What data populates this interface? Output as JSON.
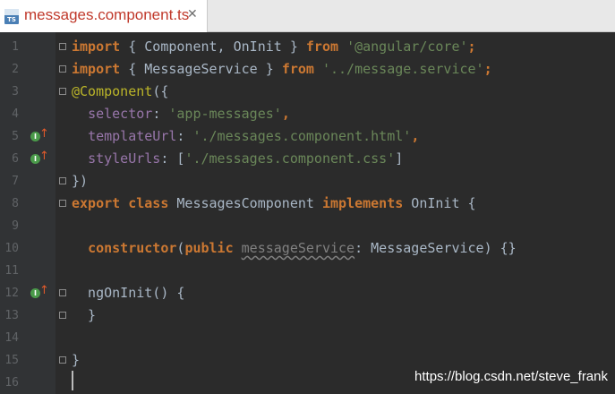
{
  "tab": {
    "title": "messages.component.ts",
    "icon_label": "TS",
    "close": "✕"
  },
  "line_numbers": [
    "1",
    "2",
    "3",
    "4",
    "5",
    "6",
    "7",
    "8",
    "9",
    "10",
    "11",
    "12",
    "13",
    "14",
    "15",
    "16"
  ],
  "code_lines": [
    [
      [
        "kw",
        "import"
      ],
      [
        "plain",
        " { Component, OnInit } "
      ],
      [
        "kw",
        "from"
      ],
      [
        "plain",
        " "
      ],
      [
        "str",
        "'@angular/core'"
      ],
      [
        "kw",
        ";"
      ]
    ],
    [
      [
        "kw",
        "import"
      ],
      [
        "plain",
        " { MessageService } "
      ],
      [
        "kw",
        "from"
      ],
      [
        "plain",
        " "
      ],
      [
        "str",
        "'../message.service'"
      ],
      [
        "kw",
        ";"
      ]
    ],
    [
      [
        "dec",
        "@Component"
      ],
      [
        "plain",
        "({"
      ]
    ],
    [
      [
        "plain",
        "  "
      ],
      [
        "prop",
        "selector"
      ],
      [
        "plain",
        ": "
      ],
      [
        "str",
        "'app-messages'"
      ],
      [
        "kw",
        ","
      ]
    ],
    [
      [
        "plain",
        "  "
      ],
      [
        "prop",
        "templateUrl"
      ],
      [
        "plain",
        ": "
      ],
      [
        "str",
        "'./messages.component.html'"
      ],
      [
        "kw",
        ","
      ]
    ],
    [
      [
        "plain",
        "  "
      ],
      [
        "prop",
        "styleUrls"
      ],
      [
        "plain",
        ": ["
      ],
      [
        "str",
        "'./messages.component.css'"
      ],
      [
        "plain",
        "]"
      ]
    ],
    [
      [
        "plain",
        "})"
      ]
    ],
    [
      [
        "kw",
        "export"
      ],
      [
        "plain",
        " "
      ],
      [
        "kw",
        "class"
      ],
      [
        "plain",
        " MessagesComponent "
      ],
      [
        "kw",
        "implements"
      ],
      [
        "plain",
        " OnInit {"
      ]
    ],
    [
      [
        "plain",
        ""
      ]
    ],
    [
      [
        "plain",
        "  "
      ],
      [
        "kw",
        "constructor"
      ],
      [
        "plain",
        "("
      ],
      [
        "kw",
        "public"
      ],
      [
        "plain",
        " "
      ],
      [
        "unused",
        "messageService"
      ],
      [
        "plain",
        ": MessageService) {}"
      ]
    ],
    [
      [
        "plain",
        ""
      ]
    ],
    [
      [
        "plain",
        "  ngOnInit() {"
      ]
    ],
    [
      [
        "plain",
        "  }"
      ]
    ],
    [
      [
        "plain",
        ""
      ]
    ],
    [
      [
        "plain",
        "}"
      ]
    ],
    [
      [
        "plain",
        ""
      ]
    ]
  ],
  "override_icon": {
    "letter": "I",
    "arrow": "↑"
  },
  "override_lines": [
    5,
    6,
    12
  ],
  "fold_lines": [
    1,
    2,
    3,
    7,
    8,
    12,
    13,
    15
  ],
  "watermark": "https://blog.csdn.net/steve_frank",
  "colors": {
    "background": "#2b2b2b",
    "keyword": "#cc7832",
    "string": "#6a8759",
    "decorator": "#bbb529",
    "property": "#9876aa",
    "tab_title": "#c0392b"
  }
}
